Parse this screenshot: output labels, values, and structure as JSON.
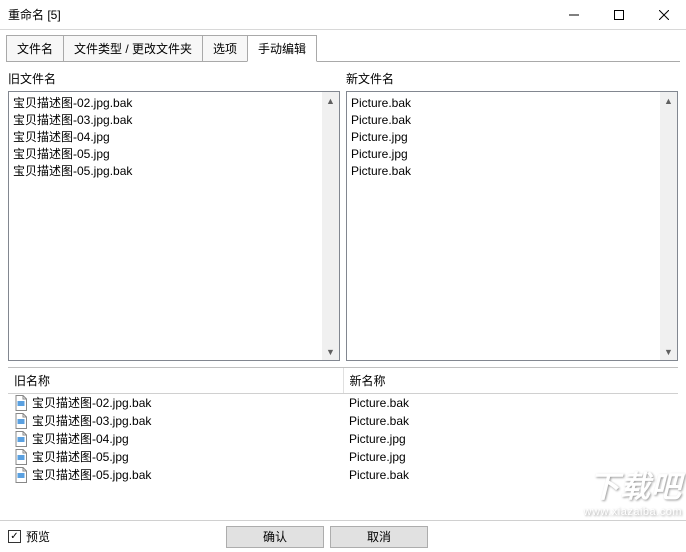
{
  "title": "重命名 [5]",
  "tabs": {
    "t0": "文件名",
    "t1": "文件类型 / 更改文件夹",
    "t2": "选项",
    "t3": "手动编辑"
  },
  "labels": {
    "old_filename": "旧文件名",
    "new_filename": "新文件名",
    "old_name": "旧名称",
    "new_name": "新名称",
    "preview": "预览",
    "ok": "确认",
    "cancel": "取消"
  },
  "watermark": {
    "main": "下载吧",
    "sub": "www.xiazaiba.com"
  },
  "old_list": [
    "宝贝描述图-02.jpg.bak",
    "宝贝描述图-03.jpg.bak",
    "宝贝描述图-04.jpg",
    "宝贝描述图-05.jpg",
    "宝贝描述图-05.jpg.bak"
  ],
  "new_list": [
    "Picture.bak",
    "Picture.bak",
    "Picture.jpg",
    "Picture.jpg",
    "Picture.bak"
  ],
  "preview_rows": [
    {
      "old": "宝贝描述图-02.jpg.bak",
      "new": "Picture.bak"
    },
    {
      "old": "宝贝描述图-03.jpg.bak",
      "new": "Picture.bak"
    },
    {
      "old": "宝贝描述图-04.jpg",
      "new": "Picture.jpg"
    },
    {
      "old": "宝贝描述图-05.jpg",
      "new": "Picture.jpg"
    },
    {
      "old": "宝贝描述图-05.jpg.bak",
      "new": "Picture.bak"
    }
  ]
}
